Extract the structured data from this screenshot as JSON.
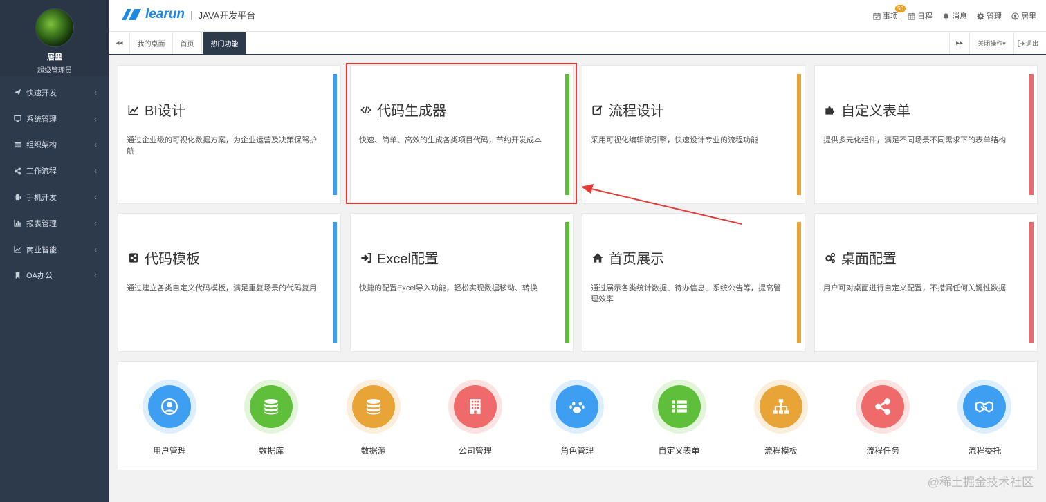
{
  "sidebar": {
    "user": {
      "name": "居里",
      "role": "超级管理员"
    },
    "items": [
      {
        "label": "快速开发",
        "icon": "paper-plane-icon"
      },
      {
        "label": "系统管理",
        "icon": "desktop-icon"
      },
      {
        "label": "组织架构",
        "icon": "organization-icon"
      },
      {
        "label": "工作流程",
        "icon": "share-icon"
      },
      {
        "label": "手机开发",
        "icon": "android-icon"
      },
      {
        "label": "报表管理",
        "icon": "bar-chart-icon"
      },
      {
        "label": "商业智能",
        "icon": "line-chart-icon"
      },
      {
        "label": "OA办公",
        "icon": "bookmark-icon"
      }
    ],
    "chevron": "‹"
  },
  "header": {
    "brand": "learun",
    "separator": "|",
    "subtitle": "JAVA开发平台",
    "links": [
      {
        "label": "事项",
        "icon": "calendar-check-icon",
        "badge": "50"
      },
      {
        "label": "日程",
        "icon": "calendar-icon"
      },
      {
        "label": "消息",
        "icon": "bell-icon"
      },
      {
        "label": "管理",
        "icon": "gear-icon"
      },
      {
        "label": "居里",
        "icon": "user-icon"
      }
    ]
  },
  "tabs": {
    "items": [
      {
        "label": "我的桌面",
        "active": false
      },
      {
        "label": "首页",
        "active": false
      },
      {
        "label": "热门功能",
        "active": true
      }
    ],
    "prev": "◂◂",
    "next": "▸▸",
    "close_ops": "关闭操作▾",
    "logout": "退出"
  },
  "cards": [
    {
      "title": "BI设计",
      "desc": "通过企业级的可视化数据方案，为企业运营及决策保驾护航",
      "icon": "line-chart-icon",
      "color": "#3d9ef2"
    },
    {
      "title": "代码生成器",
      "desc": "快速、简单、高效的生成各类项目代码，节约开发成本",
      "icon": "code-icon",
      "color": "#5fbf3a"
    },
    {
      "title": "流程设计",
      "desc": "采用可视化编辑流引擎，快速设计专业的流程功能",
      "icon": "edit-icon",
      "color": "#e9a438"
    },
    {
      "title": "自定义表单",
      "desc": "提供多元化组件，满足不同场景不同需求下的表单结构",
      "icon": "puzzle-icon",
      "color": "#ef6b6b"
    },
    {
      "title": "代码模板",
      "desc": "通过建立各类自定义代码模板，满足重复场景的代码复用",
      "icon": "share-square-icon",
      "color": "#3d9ef2"
    },
    {
      "title": "Excel配置",
      "desc": "快捷的配置Excel导入功能，轻松实现数据移动、转换",
      "icon": "sign-in-icon",
      "color": "#5fbf3a"
    },
    {
      "title": "首页展示",
      "desc": "通过展示各类统计数据、待办信息、系统公告等，提高管理效率",
      "icon": "home-icon",
      "color": "#e9a438"
    },
    {
      "title": "桌面配置",
      "desc": "用户可对桌面进行自定义配置，不措漏任何关键性数据",
      "icon": "cogs-icon",
      "color": "#ef6b6b"
    }
  ],
  "quick": [
    {
      "label": "用户管理",
      "icon": "user-icon",
      "color": "#3d9ef2",
      "bg": "#ddefff"
    },
    {
      "label": "数据库",
      "icon": "database-icon",
      "color": "#5fbf3a",
      "bg": "#e2f4d9"
    },
    {
      "label": "数据源",
      "icon": "database-icon",
      "color": "#e9a438",
      "bg": "#fbeedb"
    },
    {
      "label": "公司管理",
      "icon": "building-icon",
      "color": "#ef6b6b",
      "bg": "#fde2e2"
    },
    {
      "label": "角色管理",
      "icon": "paw-icon",
      "color": "#3d9ef2",
      "bg": "#ddefff"
    },
    {
      "label": "自定义表单",
      "icon": "list-icon",
      "color": "#5fbf3a",
      "bg": "#e2f4d9"
    },
    {
      "label": "流程模板",
      "icon": "sitemap-icon",
      "color": "#e9a438",
      "bg": "#fbeedb"
    },
    {
      "label": "流程任务",
      "icon": "share-icon",
      "color": "#ef6b6b",
      "bg": "#fde2e2"
    },
    {
      "label": "流程委托",
      "icon": "handshake-icon",
      "color": "#3d9ef2",
      "bg": "#ddefff"
    }
  ],
  "watermark": "@稀土掘金技术社区"
}
